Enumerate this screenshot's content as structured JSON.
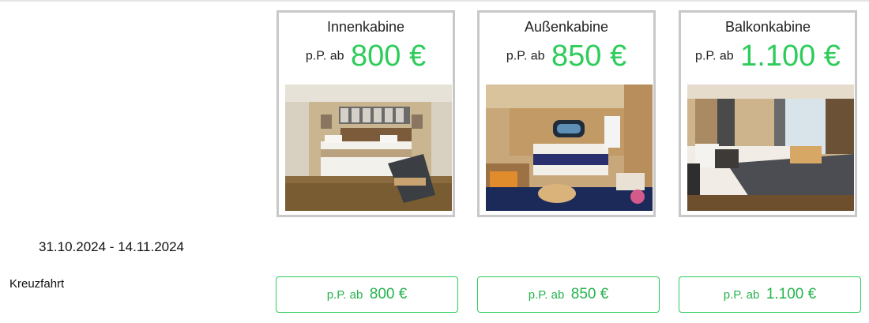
{
  "cabins": [
    {
      "title": "Innenkabine",
      "price_prefix": "p.P. ab",
      "price": "800 €",
      "photo": "inside-cabin-photo"
    },
    {
      "title": "Außenkabine",
      "price_prefix": "p.P. ab",
      "price": "850 €",
      "photo": "ocean-view-cabin-photo"
    },
    {
      "title": "Balkonkabine",
      "price_prefix": "p.P. ab",
      "price": "1.100 €",
      "photo": "balcony-cabin-photo"
    }
  ],
  "row": {
    "date_range": "31.10.2024 - 14.11.2024",
    "category": "Kreuzfahrt",
    "buttons": [
      {
        "prefix": "p.P. ab",
        "value": "800 €"
      },
      {
        "prefix": "p.P. ab",
        "value": "850 €"
      },
      {
        "prefix": "p.P. ab",
        "value": "1.100 €"
      }
    ]
  },
  "colors": {
    "accent_green": "#2ecc5a",
    "card_border": "#c8c8c8"
  }
}
